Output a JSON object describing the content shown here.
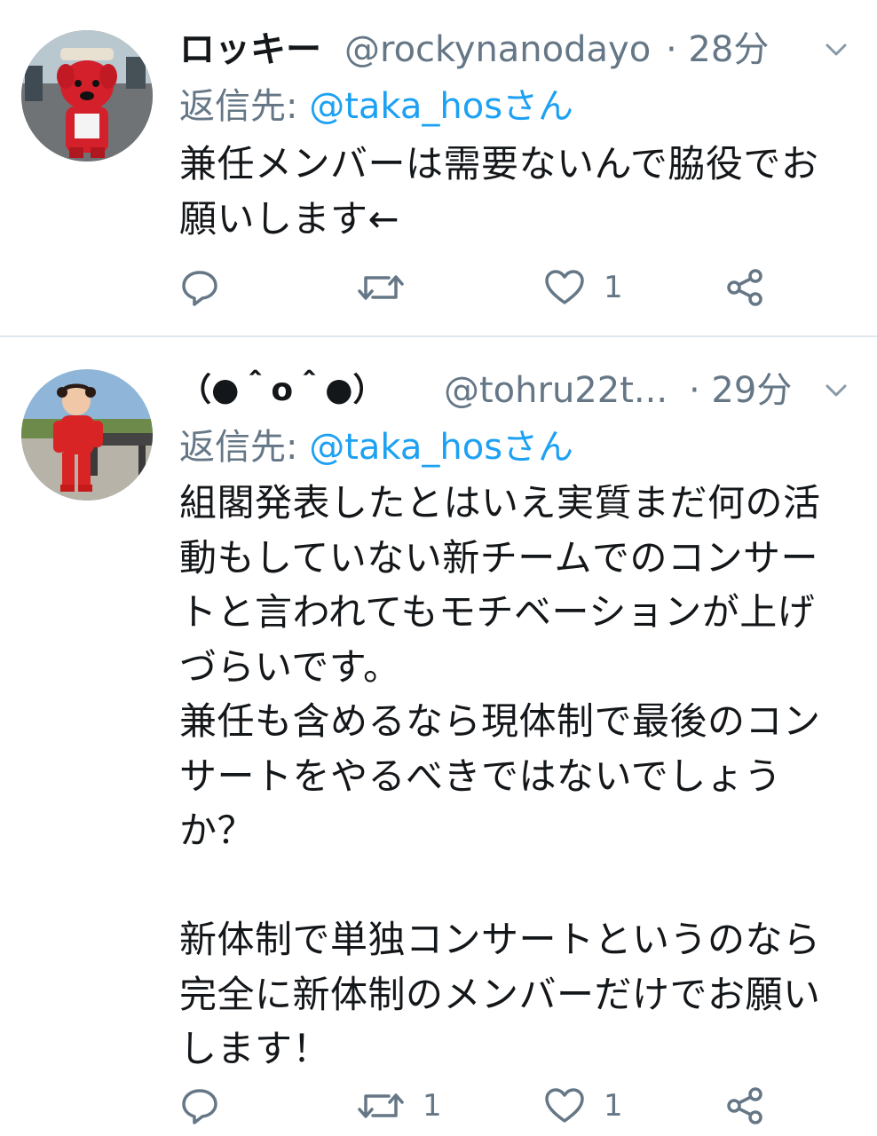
{
  "tweets": [
    {
      "display_name": "ロッキー",
      "handle": "@rockynanodayo",
      "time": "· 28分",
      "reply_label": "返信先:",
      "reply_target": "@taka_hosさん",
      "body": "兼任メンバーは需要ないんで脇役でお\n願いします←",
      "reply_count": "",
      "retweet_count": "",
      "like_count": "1",
      "icons": [
        "reply-icon",
        "retweet-icon",
        "heart-icon",
        "share-icon",
        "chevron-down-icon"
      ]
    },
    {
      "display_name": "（●＾o＾●）",
      "handle": "@tohru22t...",
      "time": "· 29分",
      "reply_label": "返信先:",
      "reply_target": "@taka_hosさん",
      "body": "組閣発表したとはいえ実質まだ何の活\n動もしていない新チームでのコンサー\nトと言われてもモチベーションが上げ\nづらいです。\n兼任も含めるなら現体制で最後のコン\nサートをやるべきではないでしょう\nか？\n\n新体制で単独コンサートというのなら\n完全に新体制のメンバーだけでお願い\nします！",
      "reply_count": "",
      "retweet_count": "1",
      "like_count": "1",
      "icons": [
        "reply-icon",
        "retweet-icon",
        "heart-icon",
        "share-icon",
        "chevron-down-icon"
      ]
    }
  ],
  "colors": {
    "text": "#14171a",
    "secondary": "#657786",
    "link": "#1da1f2",
    "divider": "#e1e8ed"
  }
}
